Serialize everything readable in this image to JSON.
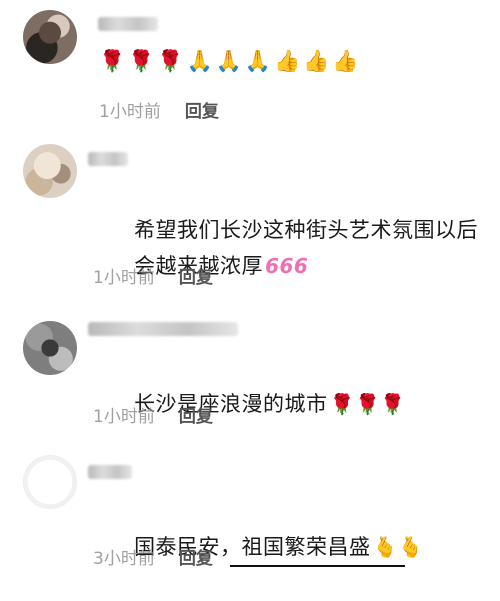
{
  "comments": [
    {
      "id": "c1",
      "text_line1": "",
      "emojis": [
        "🌹",
        "🌹",
        "🌹",
        "🙏",
        "🙏",
        "🙏",
        "👍",
        "👍",
        "👍"
      ],
      "time": "1小时前",
      "reply_label": "回复"
    },
    {
      "id": "c2",
      "text_line1": "希望我们长沙这种街头艺术氛围以后",
      "text_line2": "会越来越浓厚",
      "trailing_emoji": "666",
      "time": "1小时前",
      "reply_label": "回复"
    },
    {
      "id": "c3",
      "text_line1": "长沙是座浪漫的城市",
      "trailing_emoji": "🌹🌹🌹",
      "time": "1小时前",
      "reply_label": "回复"
    },
    {
      "id": "c4",
      "text_line1": "国泰民安，祖国繁荣昌盛",
      "trailing_emoji": "🫰🫰",
      "time": "3小时前",
      "reply_label": "回复"
    }
  ],
  "colors": {
    "text": "#1a1a1a",
    "meta": "#a0a0a0",
    "reply": "#555555"
  }
}
